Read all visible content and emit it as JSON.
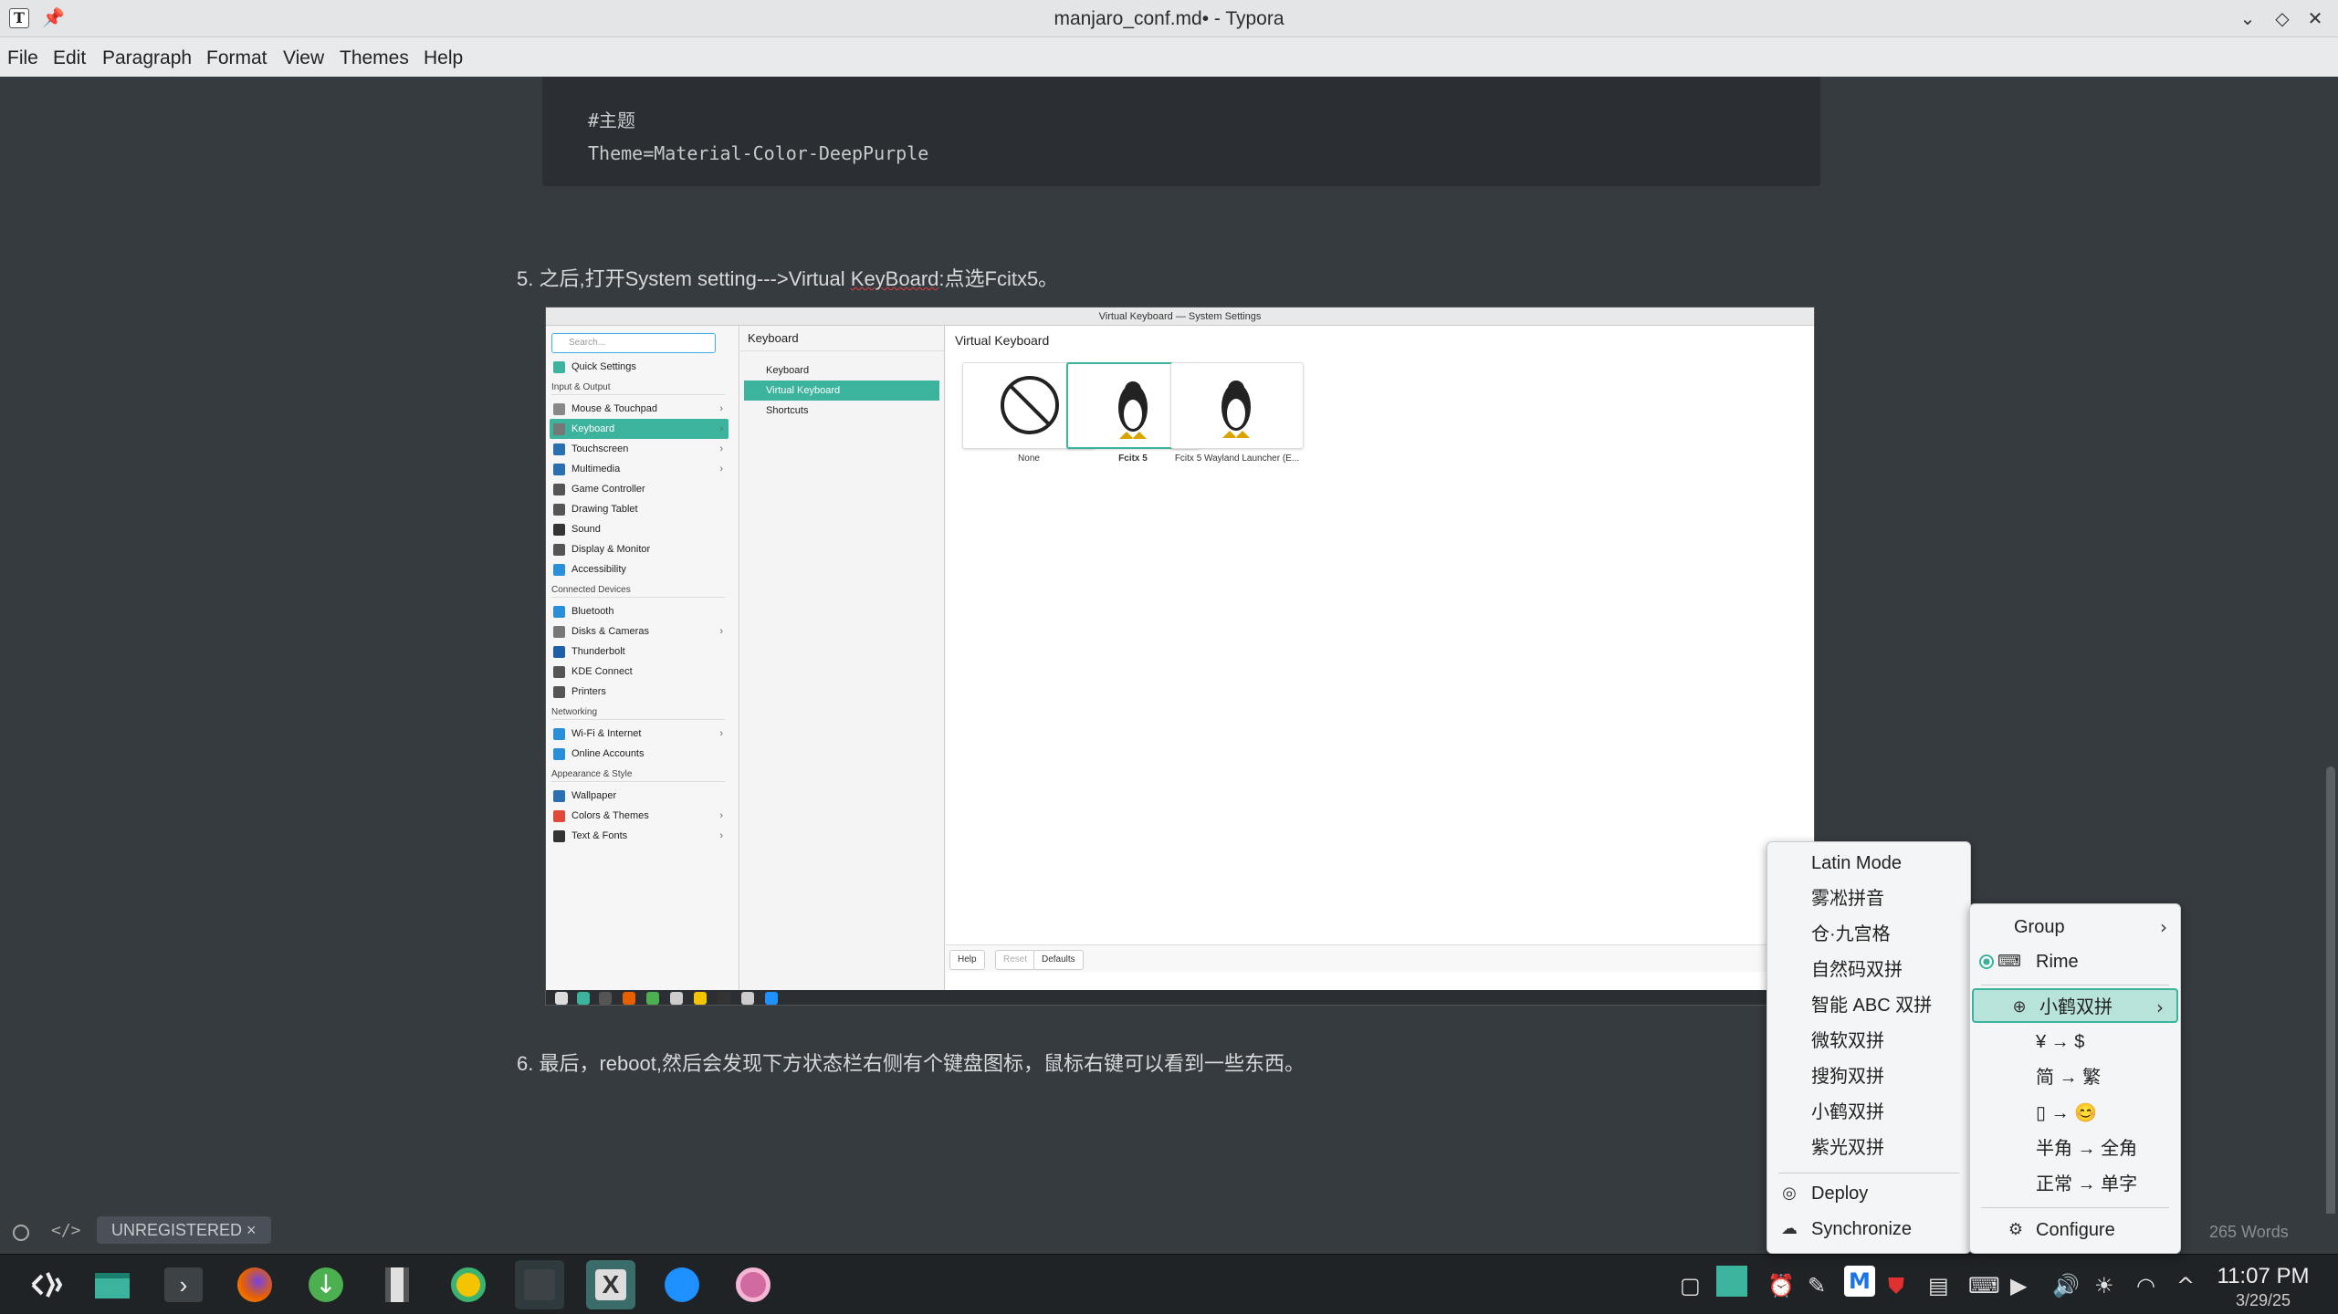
{
  "window": {
    "title": "manjaro_conf.md• - Typora"
  },
  "menubar": [
    "File",
    "Edit",
    "Paragraph",
    "Format",
    "View",
    "Themes",
    "Help"
  ],
  "code": [
    "#主题",
    "Theme=Material-Color-DeepPurple"
  ],
  "para5": {
    "num": "5.",
    "text": " 之后,打开System setting--->Virtual ",
    "underlined": "KeyBoard",
    "rest": ":点选Fcitx5。"
  },
  "para6": {
    "num": "6.",
    "text": " 最后，reboot,然后会发现下方状态栏右侧有个键盘图标，鼠标右键可以看到一些东西。"
  },
  "shot": {
    "title": "Virtual Keyboard — System Settings",
    "search_placeholder": "Search...",
    "sidebar": [
      {
        "t": "item",
        "label": "Quick Settings",
        "color": "#3bb39d"
      },
      {
        "t": "head",
        "label": "Input & Output"
      },
      {
        "t": "item",
        "label": "Mouse & Touchpad",
        "color": "#888",
        "arrow": true
      },
      {
        "t": "item",
        "label": "Keyboard",
        "color": "#777",
        "arrow": true,
        "sel": true
      },
      {
        "t": "item",
        "label": "Touchscreen",
        "color": "#2a6fb0",
        "arrow": true
      },
      {
        "t": "item",
        "label": "Multimedia",
        "color": "#2a6fb0",
        "arrow": true
      },
      {
        "t": "item",
        "label": "Game Controller",
        "color": "#555"
      },
      {
        "t": "item",
        "label": "Drawing Tablet",
        "color": "#555"
      },
      {
        "t": "item",
        "label": "Sound",
        "color": "#333"
      },
      {
        "t": "item",
        "label": "Display & Monitor",
        "color": "#555"
      },
      {
        "t": "item",
        "label": "Accessibility",
        "color": "#2a8fd8"
      },
      {
        "t": "head",
        "label": "Connected Devices"
      },
      {
        "t": "item",
        "label": "Bluetooth",
        "color": "#2a8fd8"
      },
      {
        "t": "item",
        "label": "Disks & Cameras",
        "color": "#777",
        "arrow": true
      },
      {
        "t": "item",
        "label": "Thunderbolt",
        "color": "#1f5fa8"
      },
      {
        "t": "item",
        "label": "KDE Connect",
        "color": "#555"
      },
      {
        "t": "item",
        "label": "Printers",
        "color": "#555"
      },
      {
        "t": "head",
        "label": "Networking"
      },
      {
        "t": "item",
        "label": "Wi-Fi & Internet",
        "color": "#2a8fd8",
        "arrow": true
      },
      {
        "t": "item",
        "label": "Online Accounts",
        "color": "#2a8fd8"
      },
      {
        "t": "head",
        "label": "Appearance & Style"
      },
      {
        "t": "item",
        "label": "Wallpaper",
        "color": "#2a6fb0"
      },
      {
        "t": "item",
        "label": "Colors & Themes",
        "color": "#e0483a",
        "arrow": true
      },
      {
        "t": "item",
        "label": "Text & Fonts",
        "color": "#333",
        "arrow": true
      }
    ],
    "mid_header": "Keyboard",
    "mid_items": [
      {
        "label": "Keyboard"
      },
      {
        "label": "Virtual Keyboard",
        "sel": true
      },
      {
        "label": "Shortcuts"
      }
    ],
    "main_header": "Virtual Keyboard",
    "cards": [
      {
        "label": "None"
      },
      {
        "label": "Fcitx 5",
        "sel": true
      },
      {
        "label": "Fcitx 5 Wayland Launcher (E..."
      }
    ],
    "footer": {
      "help": "Help",
      "reset": "Reset",
      "defaults": "Defaults"
    }
  },
  "status": {
    "reg": "UNREGISTERED ×",
    "words": "265 Words"
  },
  "menu1": {
    "items": [
      "Latin Mode",
      "雾凇拼音",
      "仓·九宫格",
      "自然码双拼",
      "智能 ABC 双拼",
      "微软双拼",
      "搜狗双拼",
      "小鹤双拼",
      "紫光双拼"
    ],
    "deploy": "Deploy",
    "sync": "Synchronize"
  },
  "menu2": {
    "group": "Group",
    "rime": "Rime",
    "xiaohe": "小鹤双拼",
    "items": [
      "¥ → $",
      "简 → 繁",
      "▯ → 😊",
      "半角 → 全角",
      "正常 → 单字"
    ],
    "configure": "Configure"
  },
  "clock": {
    "time": "11:07 PM",
    "date": "3/29/25"
  }
}
